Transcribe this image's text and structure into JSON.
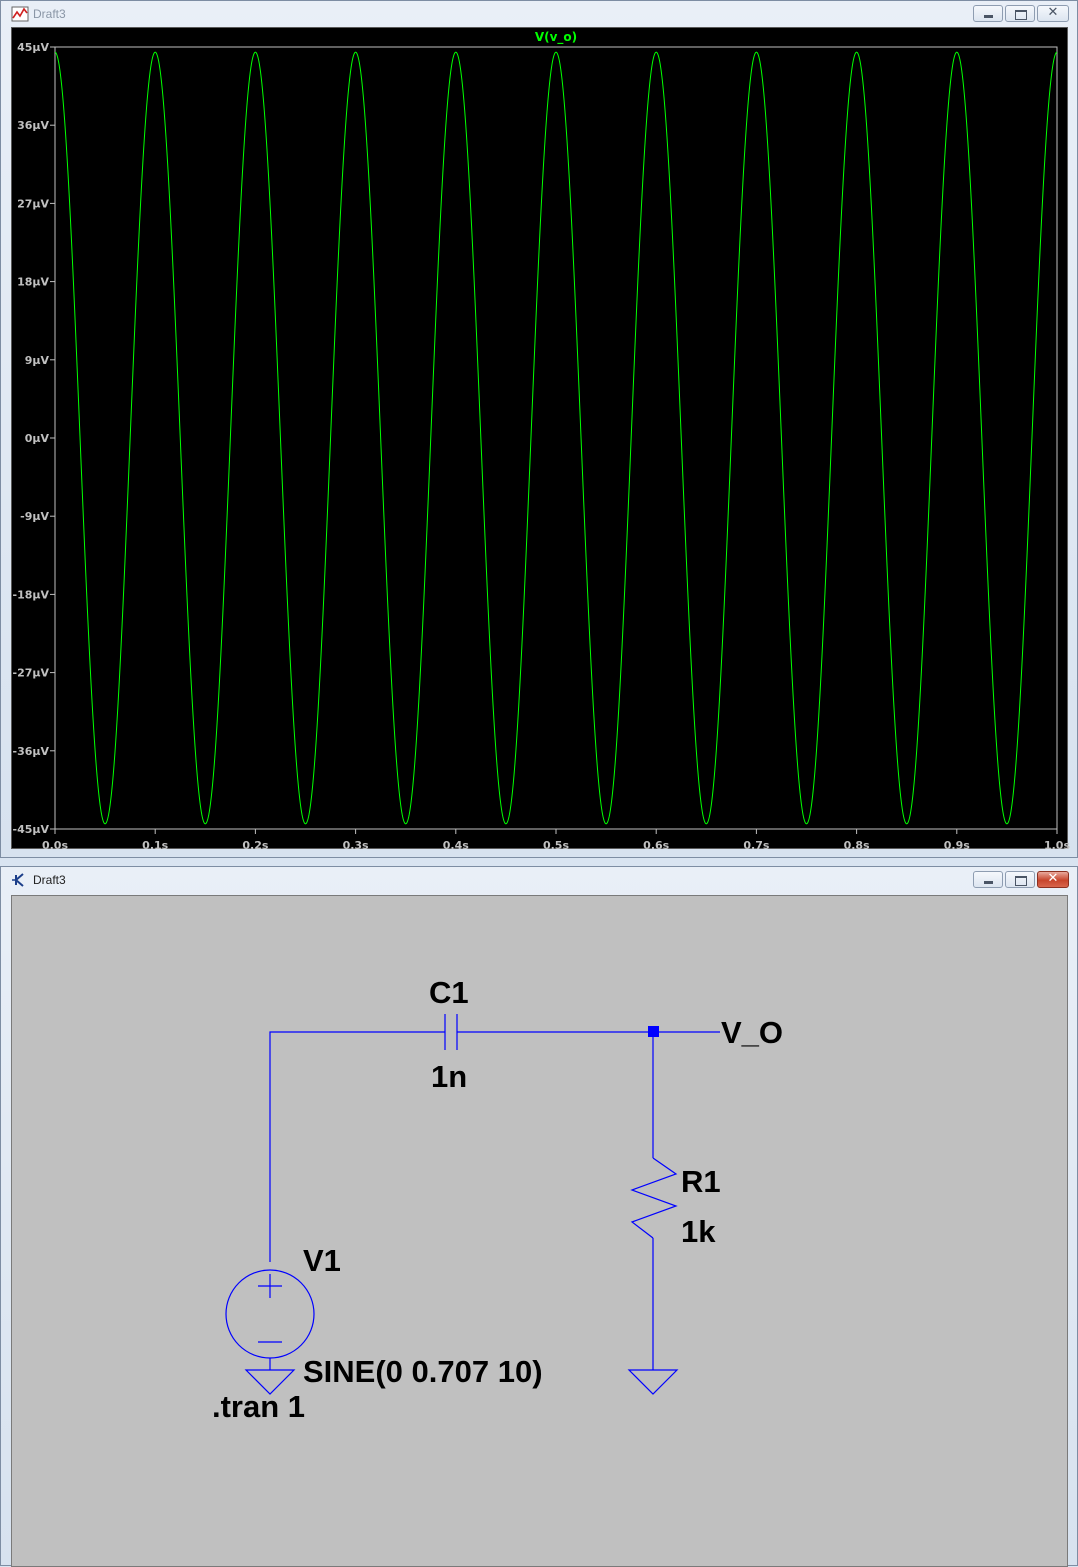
{
  "plot_window": {
    "title": "Draft3",
    "trace_name": "V(v_o)",
    "trace_color": "#00ff00"
  },
  "schematic_window": {
    "title": "Draft3",
    "components": {
      "c1": {
        "name": "C1",
        "value": "1n"
      },
      "r1": {
        "name": "R1",
        "value": "1k"
      },
      "v1": {
        "name": "V1",
        "value": "SINE(0 0.707 10)"
      },
      "net_label": "V_O",
      "directive": ".tran 1"
    },
    "wire_color": "#0000ff"
  },
  "chart_data": {
    "type": "line",
    "title": "V(v_o)",
    "xlabel": "",
    "ylabel": "",
    "x_ticks": [
      "0.0s",
      "0.1s",
      "0.2s",
      "0.3s",
      "0.4s",
      "0.5s",
      "0.6s",
      "0.7s",
      "0.8s",
      "0.9s",
      "1.0s"
    ],
    "y_ticks": [
      "45µV",
      "36µV",
      "27µV",
      "18µV",
      "9µV",
      "0µV",
      "-9µV",
      "-18µV",
      "-27µV",
      "-36µV",
      "-45µV"
    ],
    "xlim": [
      0,
      1.0
    ],
    "ylim": [
      -45,
      45
    ],
    "y_unit": "µV",
    "grid": false,
    "series": [
      {
        "name": "V(v_o)",
        "color": "#00ff00",
        "waveform": "cosine",
        "amplitude_uV": 44.4,
        "frequency_hz": 10,
        "x": [
          0.0,
          0.05,
          0.1,
          0.15,
          0.2,
          0.25,
          0.3,
          0.35,
          0.4,
          0.45,
          0.5,
          0.55,
          0.6,
          0.65,
          0.7,
          0.75,
          0.8,
          0.85,
          0.9,
          0.95,
          1.0
        ],
        "y": [
          44.4,
          -44.4,
          44.4,
          -44.4,
          44.4,
          -44.4,
          44.4,
          -44.4,
          44.4,
          -44.4,
          44.4,
          -44.4,
          44.4,
          -44.4,
          44.4,
          -44.4,
          44.4,
          -44.4,
          44.4,
          -44.4,
          44.4
        ]
      }
    ]
  }
}
